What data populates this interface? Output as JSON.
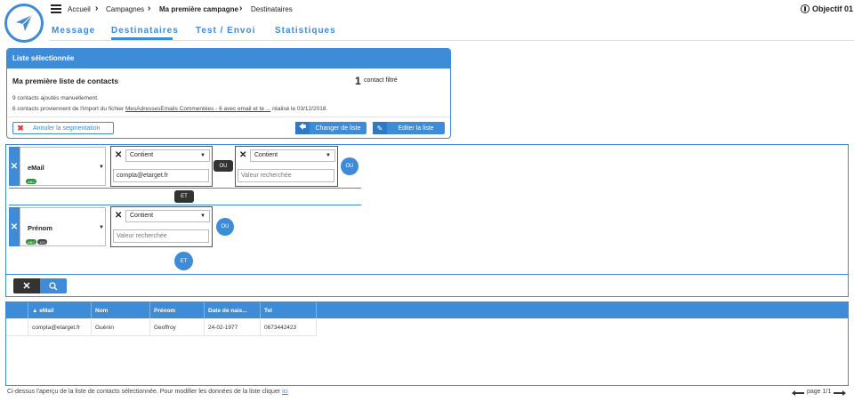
{
  "breadcrumb": {
    "items": [
      "Accueil",
      "Campagnes",
      "Ma première campagne",
      "Destinataires"
    ]
  },
  "user": {
    "name": "Objectif 01"
  },
  "tabs": [
    {
      "label": "Message"
    },
    {
      "label": "Destinataires"
    },
    {
      "label": "Test / Envoi"
    },
    {
      "label": "Statistiques"
    }
  ],
  "list_card": {
    "header": "Liste sélectionnée",
    "list_name": "Ma première liste de contacts",
    "count": "1",
    "count_label": "contact filtré",
    "info_line1": "9 contacts ajoutés manuellement.",
    "info_line2_prefix": "6 contacts proviennent de l'import du fichier ",
    "info_line2_file": "MesAdressesEmails Commentées - 6 avec email et te ...",
    "info_line2_suffix": " réalisé le 03/12/2018.",
    "cancel_label": "Annuler la segmentation",
    "change_label": "Changer de liste",
    "edit_label": "Editer la liste"
  },
  "filters": {
    "row1": {
      "field": "eMail",
      "badges": [
        "ABC"
      ],
      "cond1": {
        "operator": "Contient",
        "value": "compta@etarget.fr"
      },
      "or_label": "OU",
      "cond2": {
        "operator": "Contient",
        "placeholder": "Valeur recherchée"
      },
      "or_button": "OU"
    },
    "and_label": "ET",
    "row2": {
      "field": "Prénom",
      "badges": [
        "ABC",
        "123"
      ],
      "cond1": {
        "operator": "Contient",
        "placeholder": "Valeur recherchée"
      },
      "or_button": "OU"
    },
    "and_button": "ET"
  },
  "table": {
    "columns": [
      "eMail",
      "Nom",
      "Prénom",
      "Date de nais...",
      "Tel"
    ],
    "rows": [
      [
        "compta@etarget.fr",
        "Guénin",
        "Geoffroy",
        "24-02-1977",
        "0673442423"
      ]
    ]
  },
  "footer": {
    "text": "Ci-dessus l'aperçu de la liste de contacts sélectionnée. Pour modifier les données de la liste cliquer ",
    "link": "ici",
    "page": "page 1/1"
  },
  "colors": {
    "accent": "#3e8bd8",
    "dark": "#333333",
    "cancel": "#e0393e",
    "badge_abc": "#2f8f3a",
    "badge_num": "#444444"
  }
}
